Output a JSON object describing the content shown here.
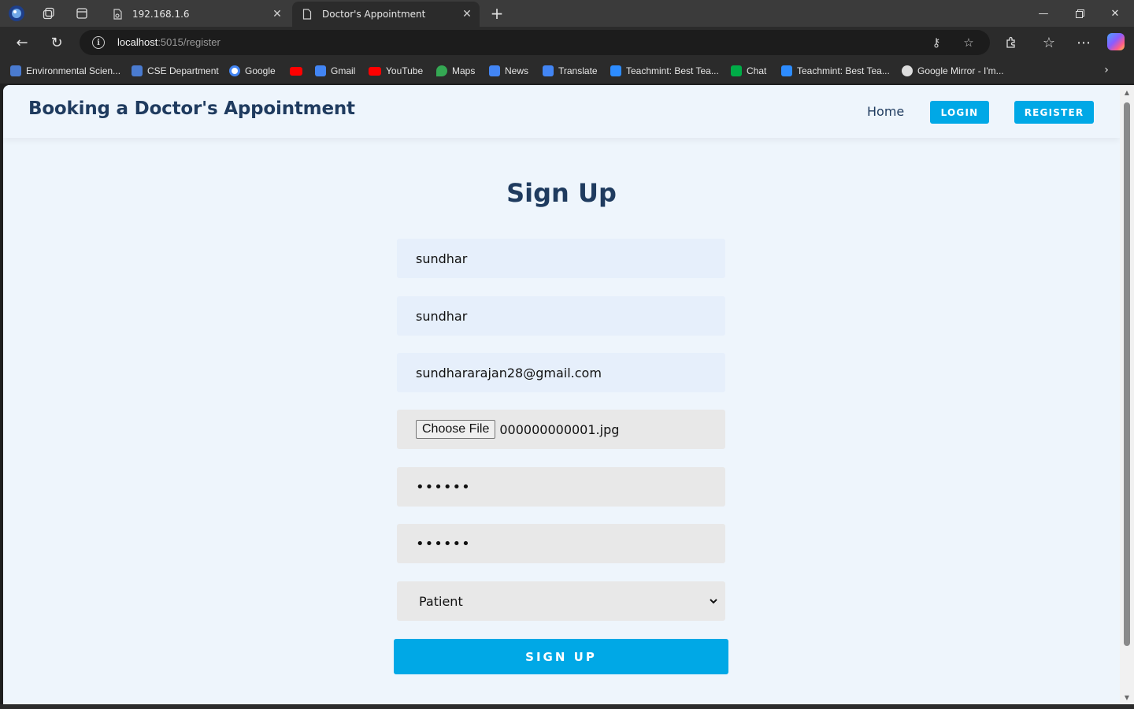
{
  "browser": {
    "tabs": [
      {
        "title": "192.168.1.6",
        "icon": "doc-sync-icon",
        "active": false
      },
      {
        "title": "Doctor's Appointment",
        "icon": "page-icon",
        "active": true
      }
    ],
    "address": {
      "host": "localhost",
      "path": ":5015/register"
    },
    "bookmarks": [
      {
        "label": "Environmental Scien...",
        "color": "#4a7bd0"
      },
      {
        "label": "CSE Department",
        "color": "#4a7bd0"
      },
      {
        "label": "Google",
        "color": "#ffffff"
      },
      {
        "label": "",
        "color": "#ff0000"
      },
      {
        "label": "Gmail",
        "color": "#4285f4"
      },
      {
        "label": "YouTube",
        "color": "#ff0000"
      },
      {
        "label": "Maps",
        "color": "#34a853"
      },
      {
        "label": "News",
        "color": "#4285f4"
      },
      {
        "label": "Translate",
        "color": "#4285f4"
      },
      {
        "label": "Teachmint: Best Tea...",
        "color": "#2d8cff"
      },
      {
        "label": "Chat",
        "color": "#00ac47"
      },
      {
        "label": "Teachmint: Best Tea...",
        "color": "#2d8cff"
      },
      {
        "label": "Google Mirror - I'm...",
        "color": "#dddddd"
      }
    ]
  },
  "site": {
    "brand": "Booking a Doctor's Appointment",
    "nav": {
      "home": "Home",
      "login": "LOGIN",
      "register": "REGISTER"
    },
    "accent": "#00a8e6",
    "navy": "#1f3b5f"
  },
  "form": {
    "title": "Sign Up",
    "first_name": "sundhar",
    "last_name": "sundhar",
    "email": "sundhararajan28@gmail.com",
    "file_button": "Choose File",
    "file_name": "000000000001.jpg",
    "password_mask": "••••••",
    "confirm_mask": "••••••",
    "role": "Patient",
    "submit": "SIGN UP"
  }
}
